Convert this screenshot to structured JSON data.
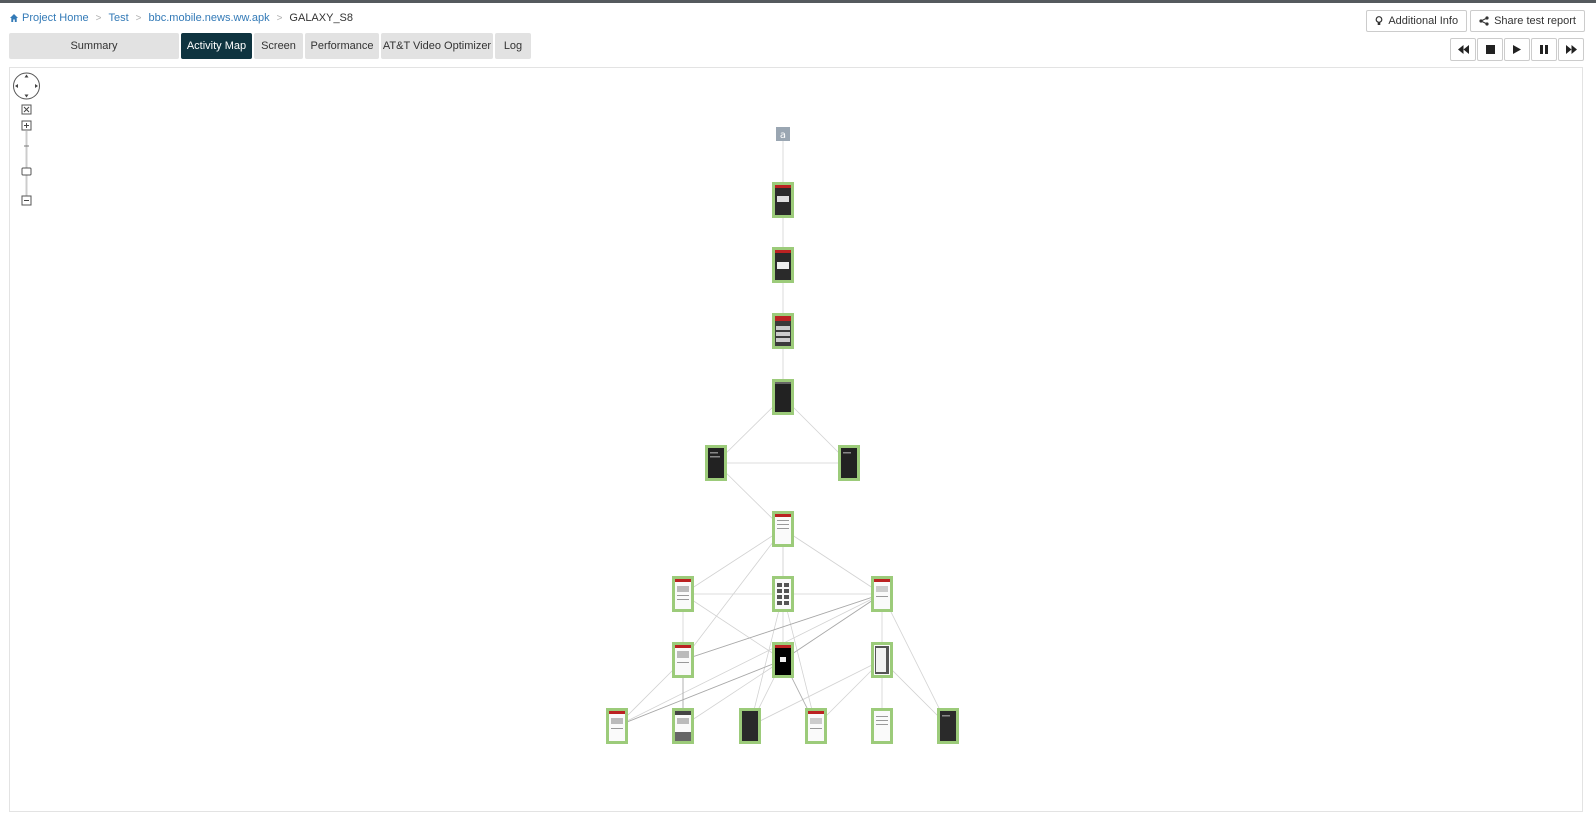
{
  "breadcrumb": {
    "home": "Project Home",
    "test": "Test",
    "app": "bbc.mobile.news.ww.apk",
    "device": "GALAXY_S8"
  },
  "tabs": [
    {
      "label": "Summary",
      "active": false
    },
    {
      "label": "Activity Map",
      "active": true
    },
    {
      "label": "Screen",
      "active": false
    },
    {
      "label": "Performance",
      "active": false
    },
    {
      "label": "AT&T Video Optimizer",
      "active": false
    },
    {
      "label": "Log",
      "active": false
    }
  ],
  "actions": {
    "additional_info": "Additional Info",
    "share_report": "Share test report"
  },
  "player": [
    "rewind-icon",
    "stop-icon",
    "play-icon",
    "pause-icon",
    "fast-forward-icon"
  ],
  "colors": {
    "active_tab": "#0f3440",
    "node_border": "#9ccb7a",
    "link": "#337ab7",
    "start_node": "#9aa6b2"
  },
  "activity_map": {
    "start_label": "a",
    "screen_count": 19
  }
}
